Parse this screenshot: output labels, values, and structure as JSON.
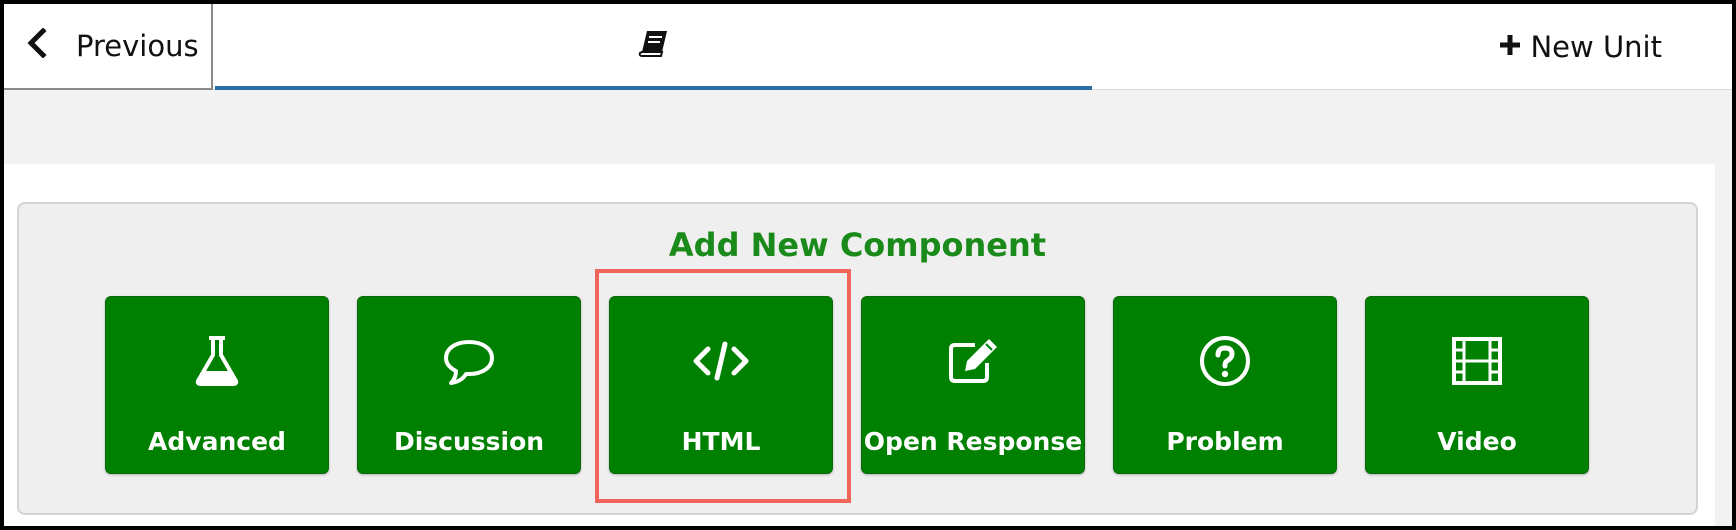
{
  "nav": {
    "previous_label": "Previous",
    "unit_icon": "book-icon",
    "new_unit_label": "New Unit"
  },
  "panel": {
    "title": "Add New Component",
    "components": [
      {
        "label": "Advanced",
        "icon": "flask-icon"
      },
      {
        "label": "Discussion",
        "icon": "speech-bubble-icon"
      },
      {
        "label": "HTML",
        "icon": "code-icon"
      },
      {
        "label": "Open Response",
        "icon": "edit-square-icon"
      },
      {
        "label": "Problem",
        "icon": "question-circle-icon"
      },
      {
        "label": "Video",
        "icon": "film-icon"
      }
    ]
  },
  "colors": {
    "component_green": "#008000",
    "title_green": "#1a8a1a",
    "tab_underline": "#2a6fa4",
    "highlight": "#f0655a"
  }
}
